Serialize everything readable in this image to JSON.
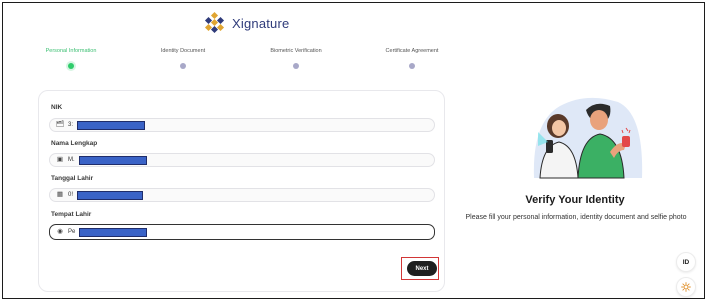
{
  "app": {
    "brand_name": "Xignature"
  },
  "stepper": {
    "steps": [
      {
        "label": "Personal Information",
        "active": true
      },
      {
        "label": "Identity Document",
        "active": false
      },
      {
        "label": "Biometric Verification",
        "active": false
      },
      {
        "label": "Certificate Agreement",
        "active": false
      }
    ]
  },
  "form": {
    "fields": [
      {
        "label": "NIK",
        "icon": "id-card-icon",
        "value_prefix": "3:"
      },
      {
        "label": "Nama Lengkap",
        "icon": "person-icon",
        "value_prefix": "M."
      },
      {
        "label": "Tanggal Lahir",
        "icon": "calendar-icon",
        "value_prefix": "0!"
      },
      {
        "label": "Tempat Lahir",
        "icon": "location-pin-icon",
        "value_prefix": "Pe"
      }
    ],
    "next_label": "Next"
  },
  "side_panel": {
    "title": "Verify Your Identity",
    "description": "Please fill your personal information, identity document and selfie photo"
  },
  "floating": {
    "language_label": "ID",
    "theme_icon": "sun-icon"
  },
  "colors": {
    "brand_blue": "#2f3b7a",
    "brand_gold": "#e0a532",
    "active_step": "#2fcc6b",
    "inactive_step": "#a8a8c8",
    "primary_button": "#1f1f1f",
    "redaction": "#3a63c7",
    "highlight": "#d23636"
  }
}
